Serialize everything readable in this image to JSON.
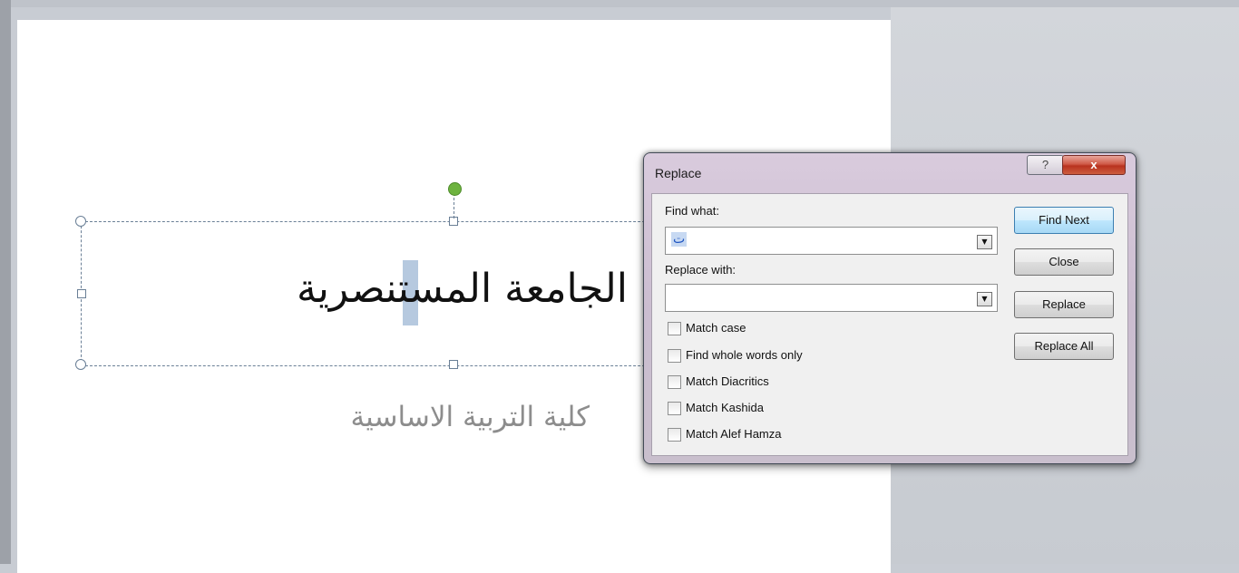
{
  "slide": {
    "title_text": "الجامعة المستنصرية",
    "subtitle_text": "كلية التربية الاساسية"
  },
  "dialog": {
    "title": "Replace",
    "help_label": "?",
    "close_label": "x",
    "find_label": "Find what:",
    "find_value": "ت",
    "replace_label": "Replace with:",
    "replace_value": "",
    "buttons": {
      "find_next": "Find Next",
      "close": "Close",
      "replace": "Replace",
      "replace_all": "Replace All"
    },
    "options": [
      {
        "label": "Match case",
        "checked": false
      },
      {
        "label": "Find whole words only",
        "checked": false
      },
      {
        "label": "Match Diacritics",
        "checked": false
      },
      {
        "label": "Match Kashida",
        "checked": false
      },
      {
        "label": "Match Alef Hamza",
        "checked": false
      }
    ]
  }
}
